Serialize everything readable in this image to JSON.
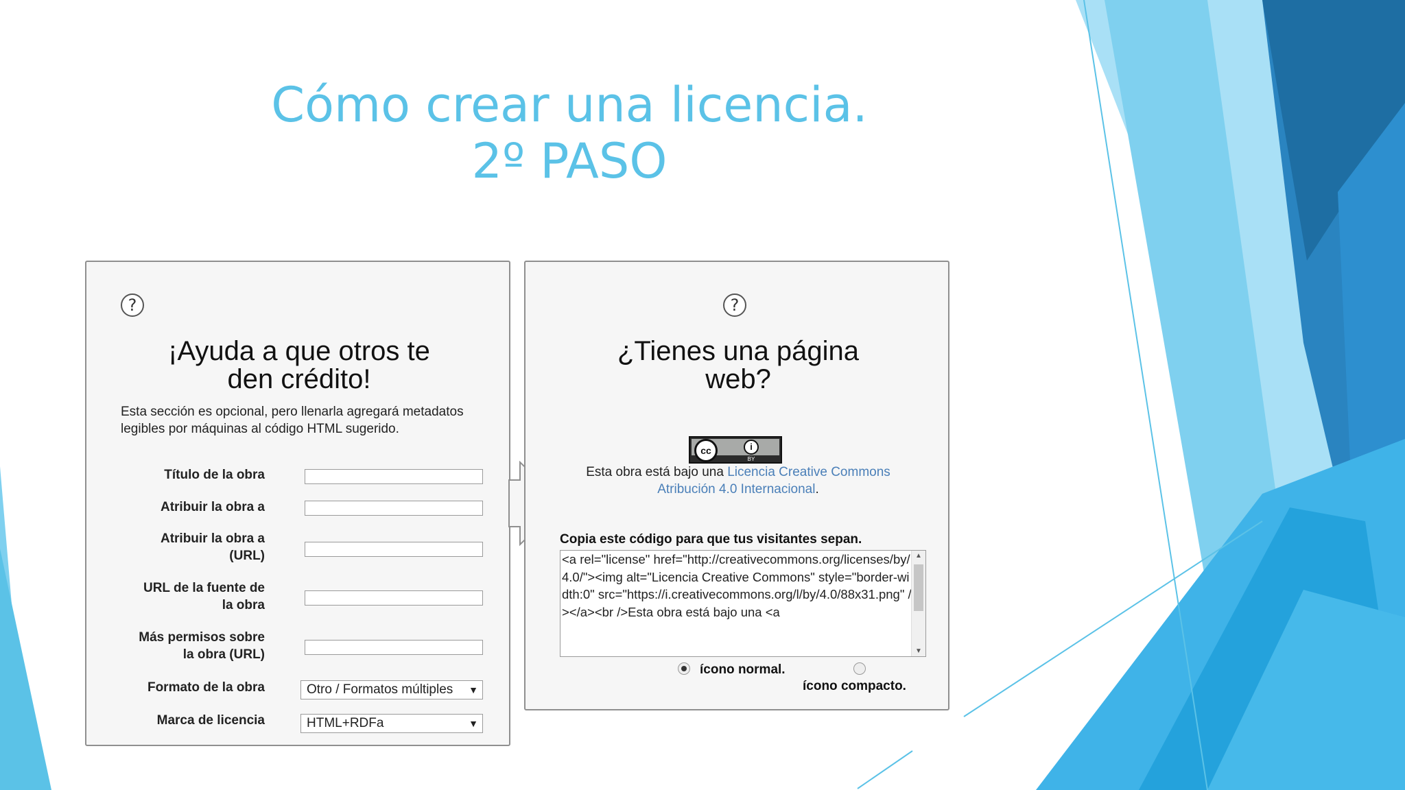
{
  "slide": {
    "title_line1": "Cómo crear una licencia.",
    "title_line2": "2º PASO"
  },
  "left_panel": {
    "help_icon": "question-mark-icon",
    "help_glyph": "?",
    "heading_line1": "¡Ayuda a que otros te",
    "heading_line2": "den crédito!",
    "description": "Esta sección es opcional, pero llenarla agregará metadatos legibles por máquinas al código HTML sugerido.",
    "fields": {
      "work_title_label": "Título de la obra",
      "attribute_to_label": "Atribuir la obra a",
      "attribute_url_label_1": "Atribuir la obra a",
      "attribute_url_label_2": "(URL)",
      "source_url_label_1": "URL de la fuente de",
      "source_url_label_2": "la obra",
      "more_permissions_label_1": "Más permisos sobre",
      "more_permissions_label_2": "la obra (URL)",
      "format_label": "Formato de la obra",
      "format_value": "Otro / Formatos múltiples",
      "license_mark_label": "Marca de licencia",
      "license_mark_value": "HTML+RDFa",
      "select_arrow": "▼"
    }
  },
  "right_panel": {
    "help_icon": "question-mark-icon",
    "help_glyph": "?",
    "heading_line1": "¿Tienes una página",
    "heading_line2": "web?",
    "badge": {
      "cc_text": "cc",
      "by_glyph": "i",
      "by_text": "BY"
    },
    "license_text": "Esta obra está bajo una ",
    "license_link_1": "Licencia Creative Commons",
    "license_link_2": "Atribución 4.0 Internacional",
    "license_period": ".",
    "copy_label": "Copia este código para que tus visitantes sepan.",
    "code": "<a rel=\"license\" href=\"http://creativecommons.org/licenses/by/4.0/\"><img alt=\"Licencia Creative Commons\" style=\"border-width:0\" src=\"https://i.creativecommons.org/l/by/4.0/88x31.png\" /></a><br />Esta obra está bajo una <a",
    "scroll_up": "▲",
    "scroll_down": "▼",
    "radio_normal_label": "ícono normal.",
    "radio_compact_label": "ícono compacto.",
    "selected_icon_option": "ícono normal."
  },
  "colors": {
    "title": "#5bc2e7",
    "link": "#4a7fb8",
    "decor_blue_dark": "#1f6fa8",
    "decor_blue_light": "#7fd0ef"
  }
}
